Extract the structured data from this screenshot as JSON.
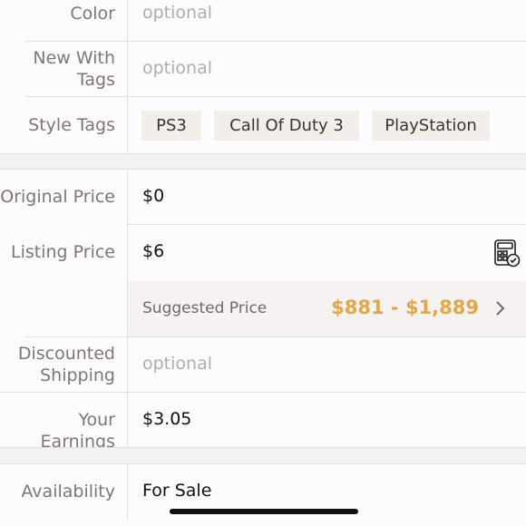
{
  "color": {
    "label": "Color",
    "placeholder": "optional"
  },
  "new_with_tags": {
    "label_line1": "New With",
    "label_line2": "Tags",
    "placeholder": "optional"
  },
  "style_tags": {
    "label": "Style Tags",
    "tags": [
      "PS3",
      "Call Of Duty 3",
      "PlayStation"
    ]
  },
  "original_price": {
    "label": "Original Price",
    "value": "$0"
  },
  "listing_price": {
    "label": "Listing Price",
    "value": "$6",
    "calculator_icon": "calculator-check-icon",
    "suggested_label": "Suggested Price",
    "suggested_range": "$881 - $1,889",
    "chevron_icon": "chevron-right-icon"
  },
  "discounted_shipping": {
    "label_line1": "Discounted",
    "label_line2": "Shipping",
    "placeholder": "optional"
  },
  "your_earnings": {
    "label": "Your Earnings",
    "value": "$3.05"
  },
  "availability": {
    "label": "Availability",
    "value": "For Sale"
  },
  "colors": {
    "accent": "#e3a74b",
    "divider": "#e3dfde",
    "section_gap": "#f4f1f1"
  }
}
